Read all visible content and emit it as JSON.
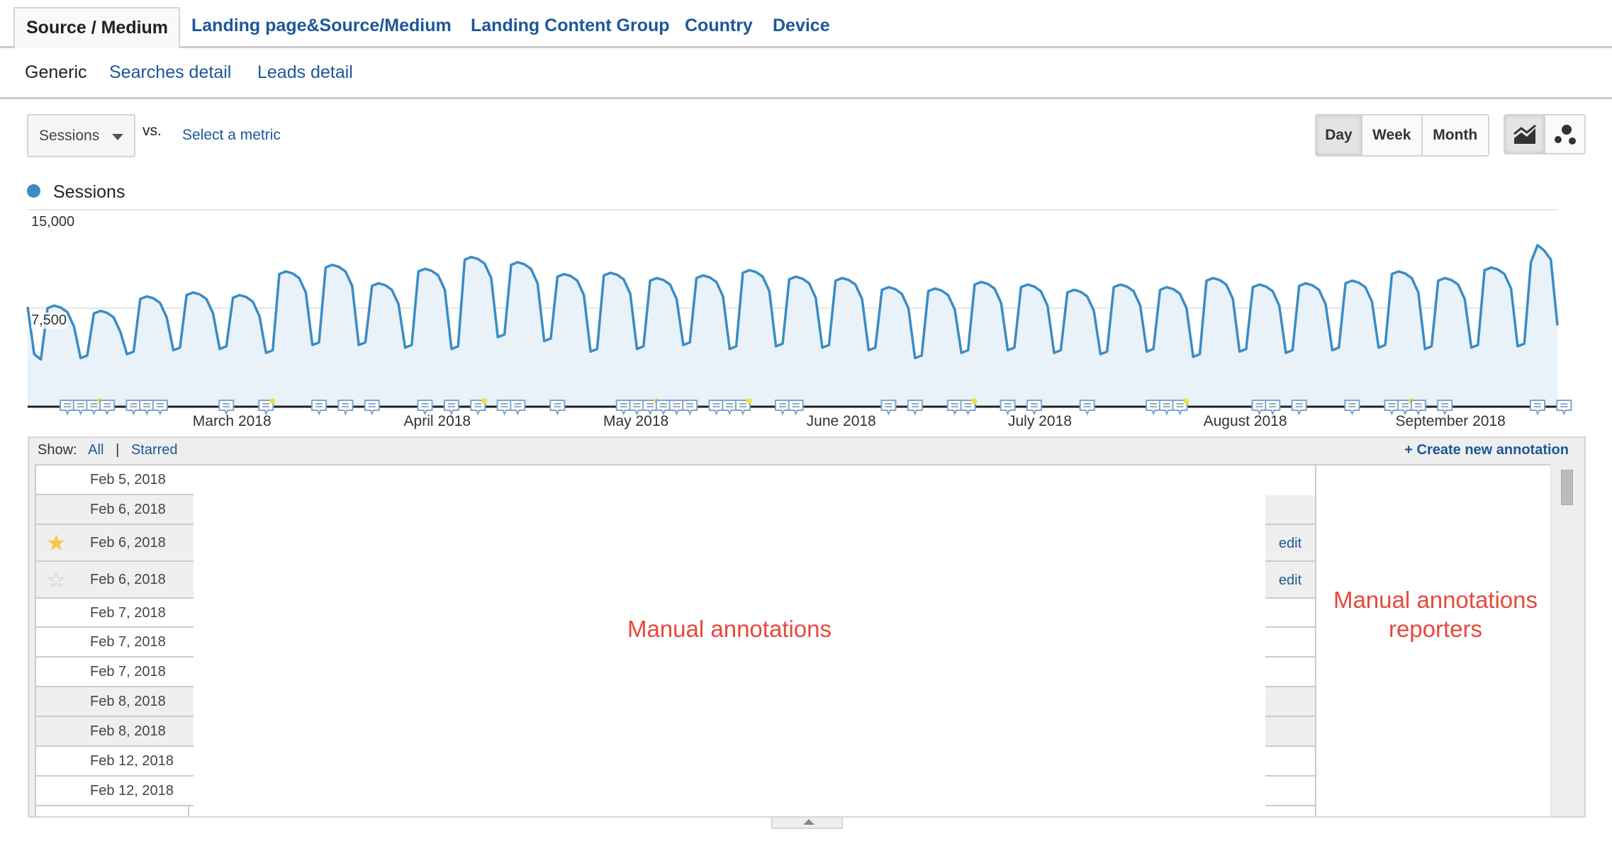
{
  "tabs": [
    "Source / Medium",
    "Landing page&Source/Medium",
    "Landing Content Group",
    "Country",
    "Device"
  ],
  "active_tab": "Source / Medium",
  "subtabs": [
    "Generic",
    "Searches detail",
    "Leads detail"
  ],
  "active_subtab": "Generic",
  "metric": {
    "selected": "Sessions",
    "vs_label": "vs.",
    "compare_link": "Select a metric"
  },
  "granularity": {
    "options": [
      "Day",
      "Week",
      "Month"
    ],
    "selected": "Day"
  },
  "chart_type_buttons": [
    {
      "icon": "line-chart-icon",
      "selected": true
    },
    {
      "icon": "motion-chart-icon",
      "selected": false
    }
  ],
  "legend": {
    "label": "Sessions",
    "color": "#3a8cc5"
  },
  "chart_data": {
    "type": "area",
    "series": [
      {
        "name": "Sessions",
        "color": "#3a8cc5",
        "values": [
          7600,
          4000,
          3600,
          7500,
          7700,
          7550,
          7200,
          6100,
          3700,
          3900,
          7100,
          7300,
          7150,
          6800,
          5700,
          4000,
          4200,
          8200,
          8400,
          8250,
          7900,
          6800,
          4300,
          4500,
          8500,
          8700,
          8550,
          8200,
          7100,
          4400,
          4600,
          8300,
          8500,
          8350,
          8000,
          6900,
          4100,
          4300,
          10100,
          10300,
          10150,
          9800,
          8700,
          4700,
          4900,
          10600,
          10800,
          10650,
          10300,
          9200,
          4700,
          4900,
          9200,
          9400,
          9250,
          8900,
          7800,
          4500,
          4700,
          10300,
          10500,
          10350,
          10000,
          8900,
          4400,
          4600,
          11200,
          11400,
          11250,
          10900,
          9800,
          5300,
          5500,
          10800,
          11000,
          10850,
          10500,
          9400,
          5000,
          5200,
          9900,
          10100,
          9950,
          9600,
          8500,
          4200,
          4400,
          10000,
          10200,
          10050,
          9700,
          8600,
          4400,
          4600,
          9600,
          9800,
          9650,
          9300,
          8200,
          4700,
          4900,
          9800,
          10000,
          9850,
          9500,
          8400,
          4400,
          4600,
          10200,
          10400,
          10250,
          9900,
          8800,
          4600,
          4800,
          9700,
          9900,
          9750,
          9400,
          8300,
          4500,
          4700,
          9600,
          9800,
          9650,
          9300,
          8200,
          4300,
          4500,
          8900,
          9100,
          8950,
          8600,
          7500,
          3700,
          3900,
          8800,
          9000,
          8850,
          8500,
          7400,
          4100,
          4300,
          9300,
          9500,
          9350,
          9000,
          7900,
          4300,
          4500,
          9100,
          9300,
          9150,
          8800,
          7700,
          4100,
          4300,
          8700,
          8900,
          8750,
          8400,
          7300,
          4000,
          4200,
          9100,
          9300,
          9150,
          8800,
          7700,
          4200,
          4400,
          8900,
          9100,
          8950,
          8600,
          7500,
          3800,
          4000,
          9600,
          9800,
          9650,
          9300,
          8200,
          4200,
          4400,
          9100,
          9300,
          9150,
          8800,
          7700,
          4100,
          4300,
          9200,
          9400,
          9250,
          8900,
          7800,
          4300,
          4500,
          9400,
          9600,
          9450,
          9100,
          8000,
          4500,
          4700,
          10100,
          10300,
          10150,
          9800,
          8700,
          4400,
          4600,
          9600,
          9800,
          9650,
          9300,
          8200,
          4500,
          4700,
          10400,
          10600,
          10450,
          10100,
          9000,
          4600,
          4800,
          11000,
          12300,
          11900,
          11200,
          6200
        ]
      }
    ],
    "x_tick_labels": [
      "March 2018",
      "April 2018",
      "May 2018",
      "June 2018",
      "July 2018",
      "August 2018",
      "September 2018"
    ],
    "y_tick_labels": [
      "15,000",
      "7,500"
    ],
    "ylim": [
      0,
      15000
    ],
    "grid": true,
    "legend_position": "top-left"
  },
  "annotations": {
    "show_label": "Show:",
    "filter_all": "All",
    "separator": "|",
    "filter_starred": "Starred",
    "create_link": "+ Create new annotation",
    "rows": [
      {
        "date": "Feb 5, 2018",
        "starred": null,
        "edit": ""
      },
      {
        "date": "Feb 6, 2018",
        "starred": null,
        "edit": ""
      },
      {
        "date": "Feb 6, 2018",
        "starred": true,
        "edit": "edit"
      },
      {
        "date": "Feb 6, 2018",
        "starred": false,
        "edit": "edit"
      },
      {
        "date": "Feb 7, 2018",
        "starred": null,
        "edit": ""
      },
      {
        "date": "Feb 7, 2018",
        "starred": null,
        "edit": ""
      },
      {
        "date": "Feb 7, 2018",
        "starred": null,
        "edit": ""
      },
      {
        "date": "Feb 8, 2018",
        "starred": null,
        "edit": ""
      },
      {
        "date": "Feb 8, 2018",
        "starred": null,
        "edit": ""
      },
      {
        "date": "Feb 12, 2018",
        "starred": null,
        "edit": ""
      },
      {
        "date": "Feb 12, 2018",
        "starred": null,
        "edit": ""
      }
    ],
    "overlay_main": "Manual annotations",
    "overlay_right_1": "Manual annotations",
    "overlay_right_2": "reporters",
    "overlay_color": "#e8483b"
  }
}
